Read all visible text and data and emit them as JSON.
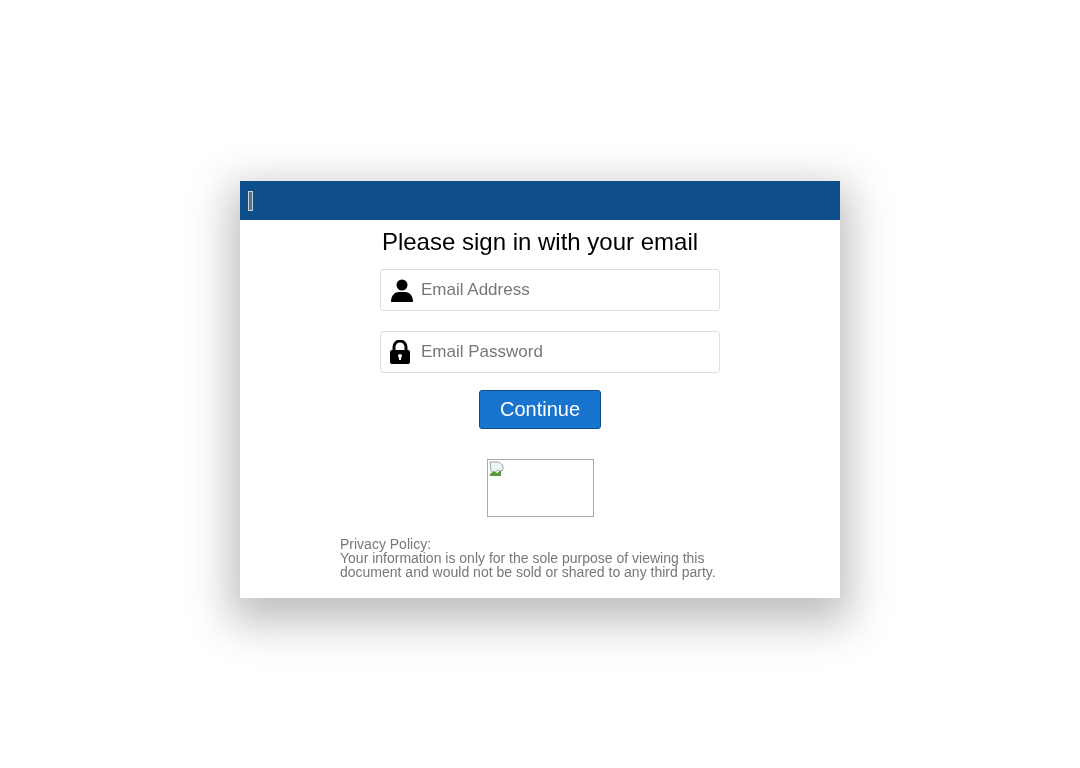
{
  "dialog": {
    "heading": "Please sign in with your email",
    "fields": [
      {
        "kind": "email",
        "placeholder": "Email Address"
      },
      {
        "kind": "password",
        "placeholder": "Email Password"
      }
    ],
    "button": "Continue",
    "privacy": {
      "title": "Privacy Policy:",
      "text": "Your information is only for the sole purpose of viewing this document and would not be sold or shared to any third party."
    }
  }
}
